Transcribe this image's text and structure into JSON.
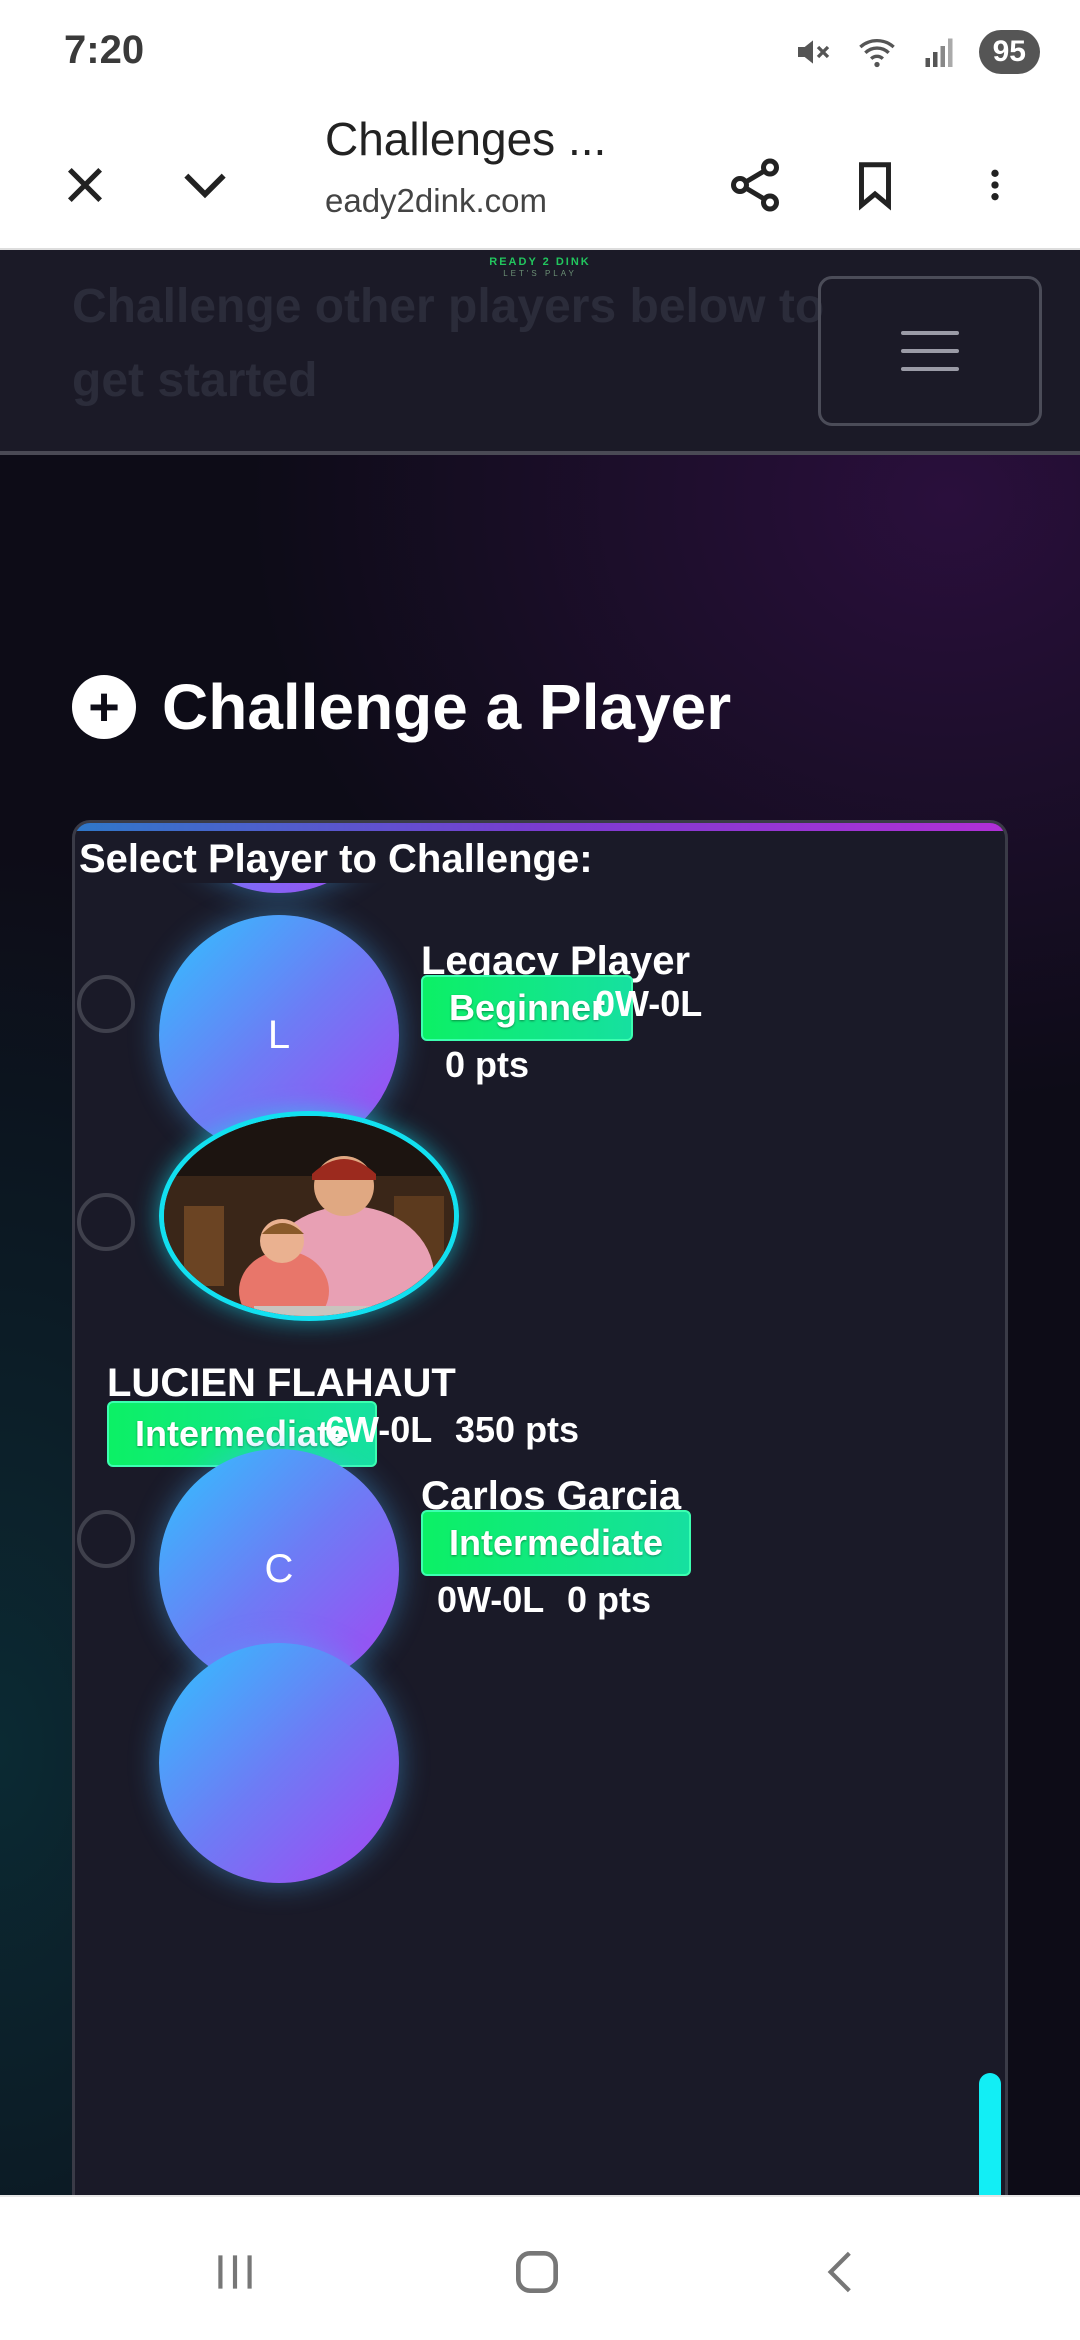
{
  "status_bar": {
    "time": "7:20",
    "battery": "95",
    "icons": [
      "mute-icon",
      "wifi-icon",
      "signal-icon"
    ]
  },
  "browser": {
    "title": "Challenges ...",
    "url": "eady2dink.com",
    "buttons": [
      "close-icon",
      "chevron-down-icon",
      "share-icon",
      "bookmark-icon",
      "more-vert-icon"
    ]
  },
  "site": {
    "brand": "READY 2 DINK",
    "brand_sub": "LET'S PLAY",
    "intro_text": "Challenge other players below to get started",
    "menu_icon": "hamburger-icon"
  },
  "section": {
    "title": "Challenge a Player",
    "card_label": "Select Player to Challenge:"
  },
  "players": [
    {
      "name": "Legacy Player",
      "initial": "L",
      "level": "Beginner",
      "record": "0W-0L",
      "points": "0 pts"
    },
    {
      "name": "LUCIEN FLAHAUT",
      "initial": "",
      "level": "Intermediate",
      "record": "6W-0L",
      "points": "350 pts"
    },
    {
      "name": "Carlos Garcia",
      "initial": "C",
      "level": "Intermediate",
      "record": "0W-0L",
      "points": "0 pts"
    }
  ],
  "colors": {
    "accent_cyan": "#12eef5",
    "badge_green": "#0cf065",
    "background": "#0d0c17",
    "card": "#1a1a28"
  }
}
